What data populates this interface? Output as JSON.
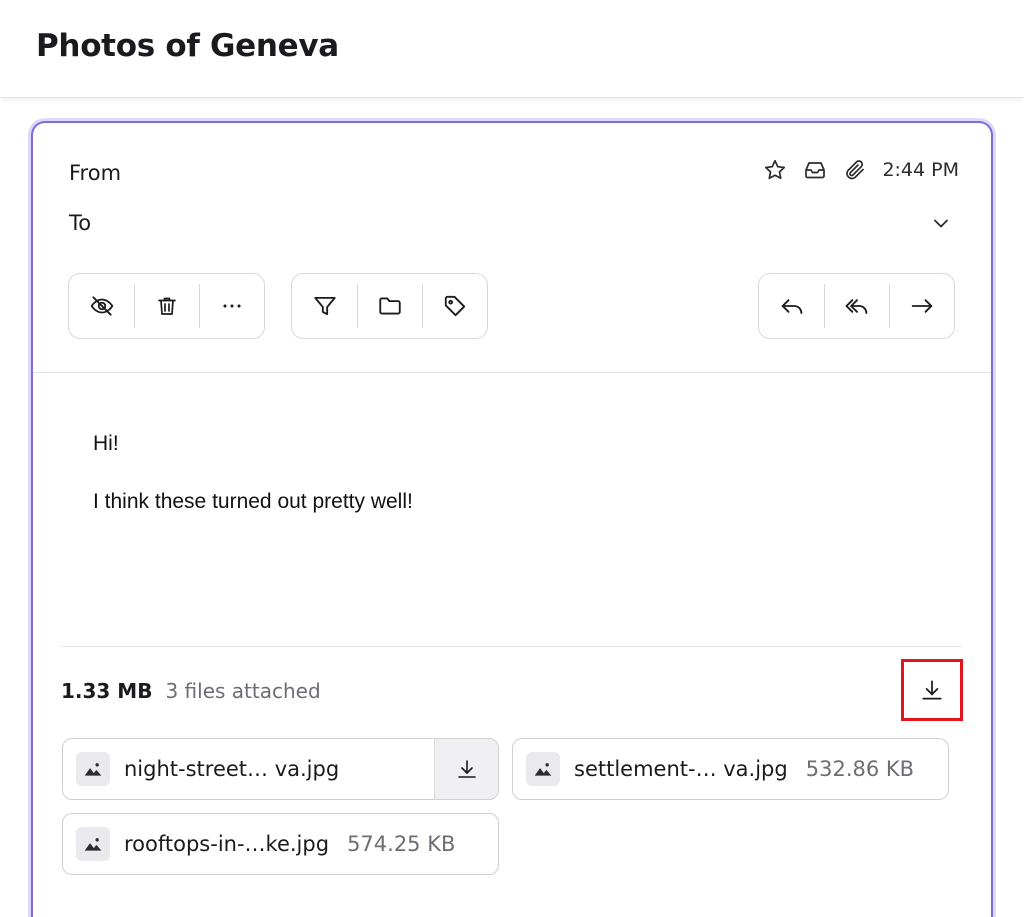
{
  "message": {
    "subject": "Photos of Geneva",
    "from_label": "From",
    "to_label": "To",
    "time": "2:44 PM",
    "body": [
      "Hi!",
      "I think these turned out pretty well!"
    ]
  },
  "toolbar": {
    "icons": [
      "eye-off-icon",
      "trash-icon",
      "more-icon",
      "filter-icon",
      "folder-icon",
      "tag-icon",
      "reply-icon",
      "reply-all-icon",
      "forward-icon"
    ]
  },
  "meta_icons": [
    "star-icon",
    "inbox-icon",
    "paperclip-icon",
    "chevron-down-icon"
  ],
  "attachments": {
    "total_size": "1.33 MB",
    "count_label": "3 files attached",
    "files": [
      {
        "name": "night-street… va.jpg",
        "size": ""
      },
      {
        "name": "settlement-… va.jpg",
        "size": "532.86 KB"
      },
      {
        "name": "rooftops-in-…ke.jpg",
        "size": "574.25 KB"
      }
    ]
  },
  "colors": {
    "accent": "#7b6ce0",
    "accent_glow": "#ded9fb",
    "highlight": "#e3141b"
  }
}
